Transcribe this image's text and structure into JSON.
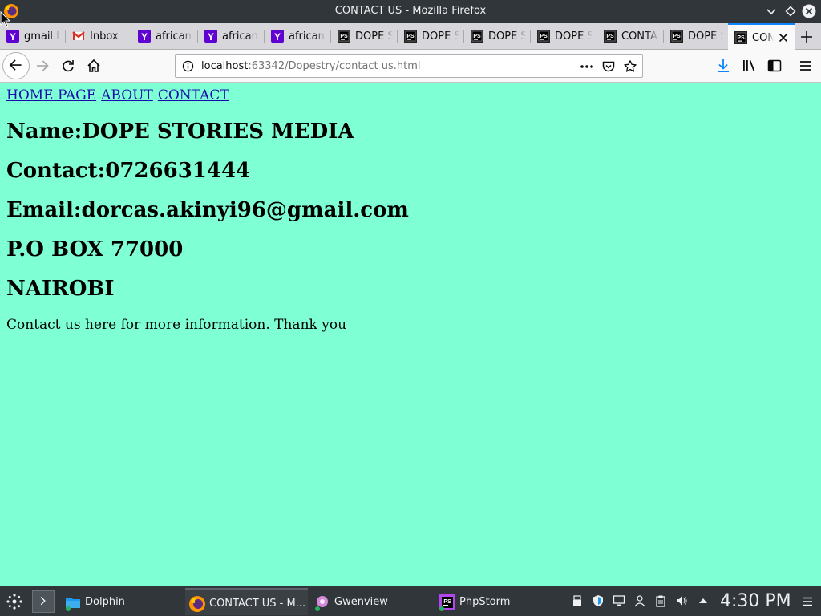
{
  "window": {
    "title": "CONTACT US - Mozilla Firefox"
  },
  "tabs": [
    {
      "label": "gmail l",
      "icon": "yahoo-icon"
    },
    {
      "label": "Inbox",
      "icon": "gmail-icon"
    },
    {
      "label": "african",
      "icon": "yahoo-icon"
    },
    {
      "label": "african",
      "icon": "yahoo-icon"
    },
    {
      "label": "african",
      "icon": "yahoo-icon"
    },
    {
      "label": "DOPE S",
      "icon": "phpstorm-icon"
    },
    {
      "label": "DOPE S",
      "icon": "phpstorm-icon"
    },
    {
      "label": "DOPE S",
      "icon": "phpstorm-icon"
    },
    {
      "label": "DOPE S",
      "icon": "phpstorm-icon"
    },
    {
      "label": "CONTA",
      "icon": "phpstorm-icon"
    },
    {
      "label": "DOPE S",
      "icon": "phpstorm-icon"
    },
    {
      "label": "CONTA",
      "icon": "phpstorm-icon",
      "active": true
    }
  ],
  "urlbar": {
    "host": "localhost",
    "path": ":63342/Dopestry/contact us.html"
  },
  "page": {
    "nav": [
      "HOME PAGE",
      "ABOUT",
      "CONTACT"
    ],
    "name": "Name:DOPE STORIES MEDIA",
    "contact": "Contact:0726631444",
    "email": "Email:dorcas.akinyi96@gmail.com",
    "pobox": "P.O BOX 77000",
    "city": "NAIROBI",
    "message": "Contact us here for more information. Thank you",
    "background_color": "#7fffd4",
    "link_color": "#1a0dab"
  },
  "taskbar": {
    "tasks": [
      {
        "label": "Dolphin",
        "icon": "dolphin-icon"
      },
      {
        "label": "CONTACT US - M...",
        "icon": "firefox-icon",
        "active": true
      },
      {
        "label": "Gwenview",
        "icon": "gwenview-icon"
      },
      {
        "label": "PhpStorm",
        "icon": "phpstorm-icon"
      }
    ],
    "clock": "4:30 PM"
  },
  "colors": {
    "titlebar": "#31363b",
    "tab_active_accent": "#0a84ff",
    "download_accent": "#0a84ff"
  }
}
